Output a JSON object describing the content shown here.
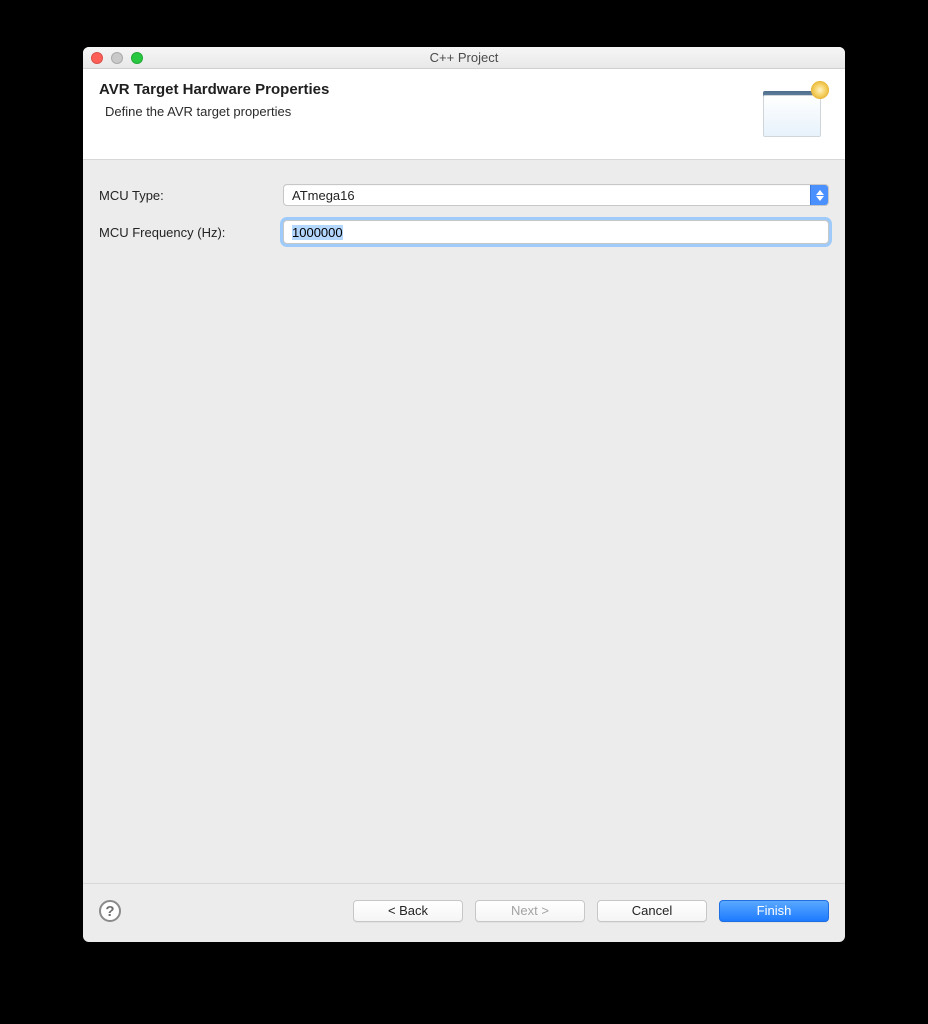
{
  "window": {
    "title": "C++ Project"
  },
  "banner": {
    "title": "AVR Target Hardware Properties",
    "subtitle": "Define the AVR target properties"
  },
  "form": {
    "mcu_type_label": "MCU Type:",
    "mcu_type_value": "ATmega16",
    "mcu_freq_label": "MCU Frequency (Hz):",
    "mcu_freq_value": "1000000"
  },
  "buttons": {
    "back": "< Back",
    "next": "Next >",
    "cancel": "Cancel",
    "finish": "Finish"
  }
}
